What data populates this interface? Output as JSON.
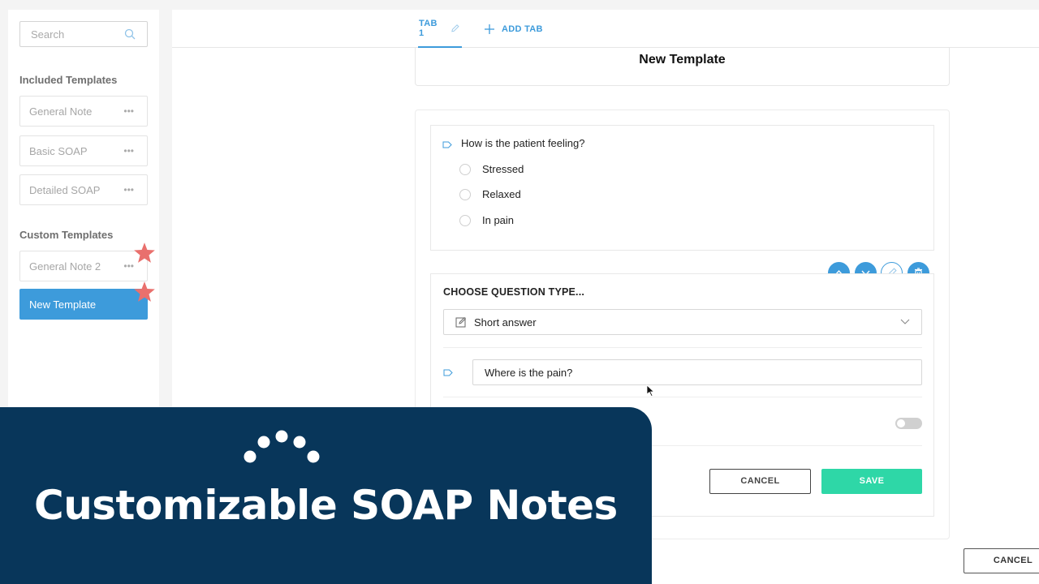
{
  "sidebar": {
    "search_placeholder": "Search",
    "included_title": "Included Templates",
    "included": [
      {
        "label": "General Note",
        "more": "•••"
      },
      {
        "label": "Basic SOAP",
        "more": "•••"
      },
      {
        "label": "Detailed SOAP",
        "more": "•••"
      }
    ],
    "custom_title": "Custom Templates",
    "custom": [
      {
        "label": "General Note 2",
        "more": "•••"
      },
      {
        "label": "New Template"
      }
    ]
  },
  "tabs": {
    "tab1": "TAB 1",
    "add_tab": "ADD TAB"
  },
  "main": {
    "template_title": "New Template",
    "question": {
      "text": "How is the patient feeling?",
      "options": [
        "Stressed",
        "Relaxed",
        "In pain"
      ]
    },
    "editor": {
      "choose_label": "CHOOSE QUESTION TYPE...",
      "type_value": "Short answer",
      "question_value": "Where is the pain?",
      "cancel_label": "CANCEL",
      "save_label": "SAVE"
    },
    "bottom_cancel": "CANCEL"
  },
  "banner": {
    "title": "Customizable SOAP Notes"
  },
  "colors": {
    "accent": "#3d9bdb",
    "save": "#2ed7a7",
    "banner": "#08365a",
    "star": "#e9706d"
  }
}
